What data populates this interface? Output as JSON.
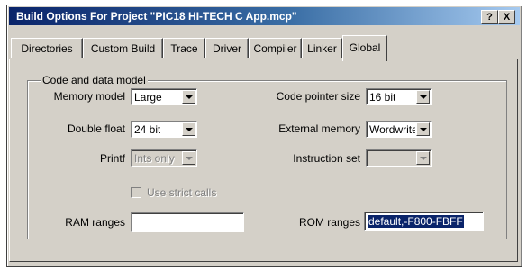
{
  "window": {
    "title": "Build Options For Project \"PIC18 HI-TECH C App.mcp\"",
    "help_button": "?",
    "close_button": "X"
  },
  "tabs": [
    {
      "label": "Directories",
      "active": false
    },
    {
      "label": "Custom Build",
      "active": false
    },
    {
      "label": "Trace",
      "active": false
    },
    {
      "label": "Driver",
      "active": false
    },
    {
      "label": "Compiler",
      "active": false
    },
    {
      "label": "Linker",
      "active": false
    },
    {
      "label": "Global",
      "active": true
    }
  ],
  "group": {
    "label": "Code and data model",
    "memory_model": {
      "label": "Memory model",
      "value": "Large"
    },
    "code_pointer_size": {
      "label": "Code pointer size",
      "value": "16 bit"
    },
    "double_float": {
      "label": "Double float",
      "value": "24 bit"
    },
    "external_memory": {
      "label": "External memory",
      "value": "Wordwrite"
    },
    "printf": {
      "label": "Printf",
      "value": "Ints only",
      "enabled": false
    },
    "instruction_set": {
      "label": "Instruction set",
      "value": "",
      "enabled": false
    },
    "use_strict_calls": {
      "label": "Use strict calls",
      "checked": false,
      "enabled": false
    },
    "ram_ranges": {
      "label": "RAM ranges",
      "value": ""
    },
    "rom_ranges": {
      "label": "ROM ranges",
      "value": "default,-F800-FBFF"
    }
  }
}
